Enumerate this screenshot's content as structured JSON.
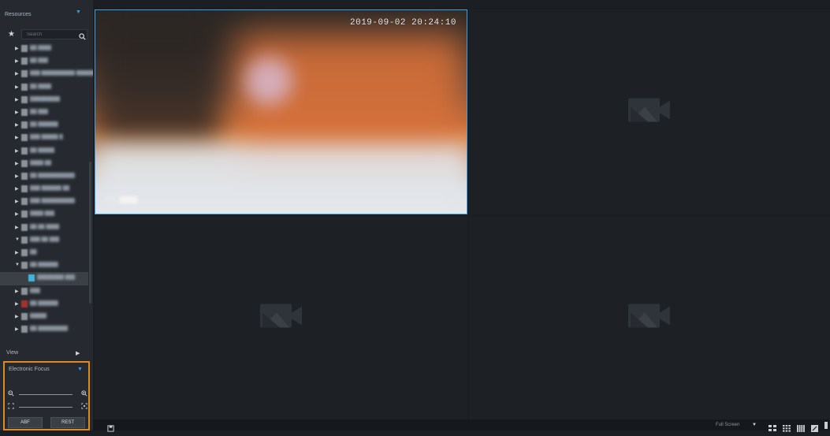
{
  "sidebar": {
    "resources_title": "Resources",
    "search_placeholder": "Search",
    "tree": [
      {
        "label": "██ ████",
        "expanded": false
      },
      {
        "label": "██ ███",
        "expanded": false
      },
      {
        "label": "███ ██████████ ██████",
        "expanded": false
      },
      {
        "label": "██ ████",
        "expanded": false
      },
      {
        "label": "█████████",
        "expanded": false
      },
      {
        "label": "██ ███",
        "expanded": false
      },
      {
        "label": "██ ██████",
        "expanded": false
      },
      {
        "label": "███ █████ █",
        "expanded": false
      },
      {
        "label": "██ █████",
        "expanded": false
      },
      {
        "label": "████ ██",
        "expanded": false
      },
      {
        "label": "██ ███████████",
        "expanded": false
      },
      {
        "label": "███ ██████ ██",
        "expanded": false
      },
      {
        "label": "███ ██████████",
        "expanded": false
      },
      {
        "label": "████ ███",
        "expanded": false
      },
      {
        "label": "██ ██ ████",
        "expanded": false
      },
      {
        "label": "███ ██ ███",
        "expanded": true
      },
      {
        "label": "██",
        "expanded": false
      },
      {
        "label": "██ ██████",
        "expanded": true
      },
      {
        "label": "████████ ███",
        "selected": true
      },
      {
        "label": "███",
        "expanded": false
      },
      {
        "label": "██ ██████",
        "expanded": false
      },
      {
        "label": "█████",
        "expanded": false
      },
      {
        "label": "██ █████████",
        "expanded": false
      }
    ],
    "view_title": "View",
    "focus": {
      "title": "Electronic Focus",
      "abf_label": "ABF",
      "rest_label": "REST"
    }
  },
  "video": {
    "timestamp": "2019-09-02 20:24:10",
    "camera_label": "ITPC-████"
  },
  "bottom": {
    "fullscreen_label": "Full Screen"
  },
  "colors": {
    "selection_border": "#3aa0e8",
    "focus_border": "#e08a1e",
    "accent": "#2f9fe6"
  }
}
